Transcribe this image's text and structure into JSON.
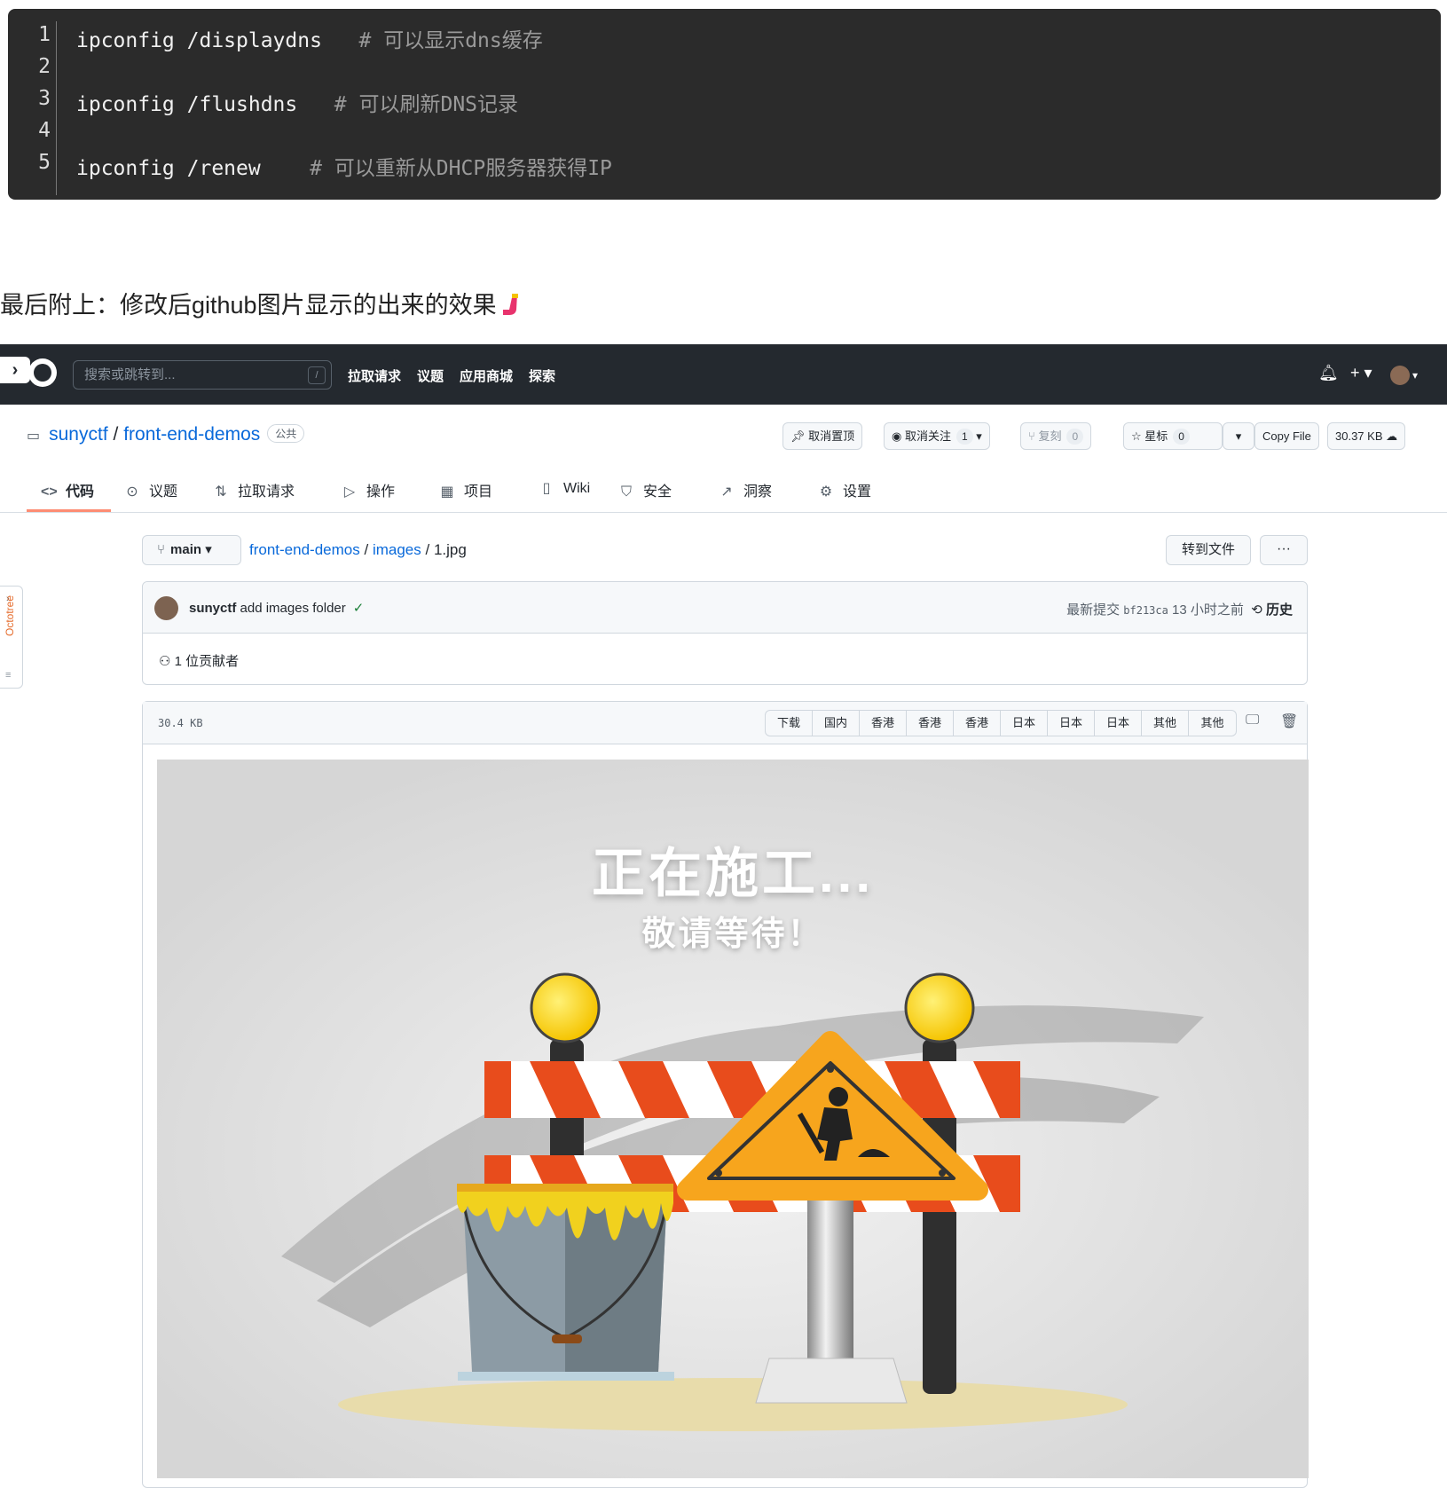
{
  "code": {
    "lines": [
      {
        "num": "1",
        "cmd": "ipconfig /displaydns",
        "gap": "   ",
        "comment": "# 可以显示dns缓存"
      },
      {
        "num": "2",
        "cmd": "",
        "gap": "",
        "comment": ""
      },
      {
        "num": "3",
        "cmd": "ipconfig /flushdns",
        "gap": "   ",
        "comment": "# 可以刷新DNS记录"
      },
      {
        "num": "4",
        "cmd": "",
        "gap": "",
        "comment": ""
      },
      {
        "num": "5",
        "cmd": "ipconfig /renew",
        "gap": "    ",
        "comment": "# 可以重新从DHCP服务器获得IP"
      }
    ]
  },
  "intro_text": "最后附上：修改后github图片显示的出来的效果",
  "github": {
    "nav": {
      "search_placeholder": "搜索或跳转到...",
      "slash_key": "/",
      "links": [
        "拉取请求",
        "议题",
        "应用商城",
        "探索"
      ]
    },
    "repo": {
      "owner": "sunyctf",
      "separator": "/",
      "name": "front-end-demos",
      "visibility": "公共",
      "actions": {
        "unpin": "取消置顶",
        "unwatch": "取消关注",
        "watch_count": "1",
        "fork": "复刻",
        "fork_count": "0",
        "star": "星标",
        "star_count": "0",
        "copy_file": "Copy File",
        "size": "30.37 KB"
      }
    },
    "tabs": [
      {
        "icon": "<>",
        "label": "代码"
      },
      {
        "icon": "⊙",
        "label": "议题"
      },
      {
        "icon": "⇅",
        "label": "拉取请求"
      },
      {
        "icon": "▷",
        "label": "操作"
      },
      {
        "icon": "▦",
        "label": "项目"
      },
      {
        "icon": "▯",
        "label": "Wiki"
      },
      {
        "icon": "⛉",
        "label": "安全"
      },
      {
        "icon": "↗",
        "label": "洞察"
      },
      {
        "icon": "⚙",
        "label": "设置"
      }
    ],
    "branch": "main",
    "breadcrumb": {
      "repo": "front-end-demos",
      "folder": "images",
      "file": "1.jpg",
      "sep": "/"
    },
    "goto_file": "转到文件",
    "more": "···",
    "commit": {
      "author": "sunyctf",
      "message": "add images folder",
      "check": "✓",
      "latest_label": "最新提交",
      "sha": "bf213ca",
      "time": "13 小时之前",
      "history": "历史"
    },
    "contributors": "1 位贡献者",
    "octotree_label": "Octotree",
    "file": {
      "size": "30.4 KB",
      "buttons": [
        "下载",
        "国内",
        "香港",
        "香港",
        "香港",
        "日本",
        "日本",
        "日本",
        "其他",
        "其他"
      ]
    },
    "image": {
      "title": "正在施工...",
      "subtitle": "敬请等待！"
    }
  }
}
